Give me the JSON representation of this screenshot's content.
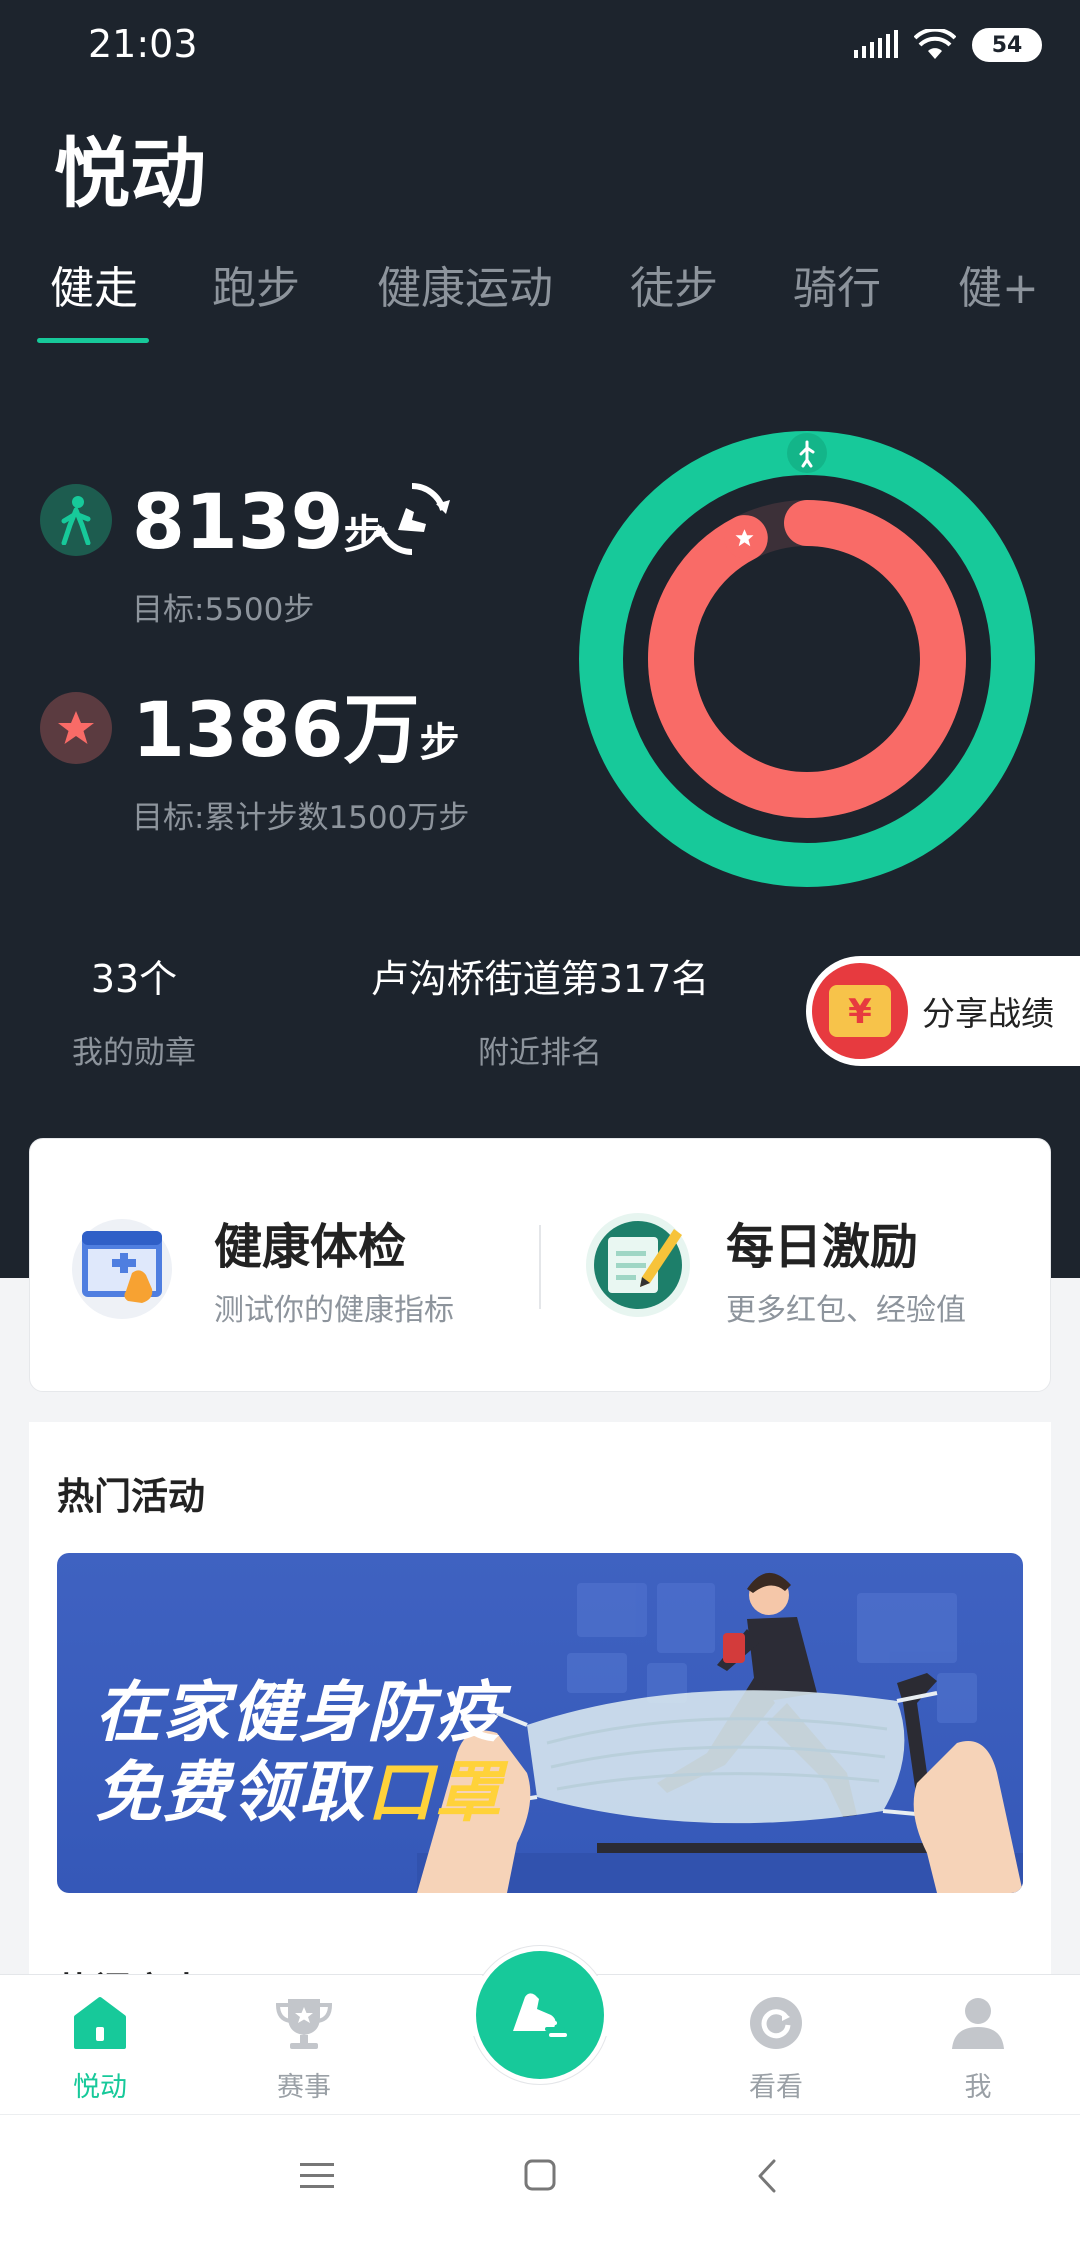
{
  "status": {
    "time": "21:03",
    "battery": "54"
  },
  "app": {
    "title": "悦动"
  },
  "tabs": [
    {
      "label": "健走",
      "active": true
    },
    {
      "label": "跑步"
    },
    {
      "label": "健康运动"
    },
    {
      "label": "徒步"
    },
    {
      "label": "骑行"
    },
    {
      "label": "健+"
    }
  ],
  "stats": {
    "today_steps": "8139",
    "today_unit": "步",
    "today_goal": "目标:5500步",
    "total_steps": "1386万",
    "total_unit": "步",
    "total_goal": "目标:累计步数1500万步"
  },
  "rings": {
    "outer_progress": 1.0,
    "inner_progress": 0.924,
    "outer_color": "#17c99a",
    "inner_color": "#f96b67"
  },
  "summary": {
    "medals_value": "33个",
    "medals_label": "我的勋章",
    "rank_value": "卢沟桥街道第317名",
    "rank_label": "附近排名",
    "share_label": "分享战绩",
    "share_symbol": "¥"
  },
  "cards": {
    "health_check_title": "健康体检",
    "health_check_sub": "测试你的健康指标",
    "daily_title": "每日激励",
    "daily_sub": "更多红包、经验值"
  },
  "activities": {
    "section_title": "热门活动",
    "banner_line1": "在家健身防疫",
    "banner_line2_a": "免费领取",
    "banner_line2_b": "口罩",
    "next_section_peek": "热门赛事"
  },
  "bottom_nav": [
    {
      "label": "悦动",
      "icon": "home-icon",
      "active": true
    },
    {
      "label": "赛事",
      "icon": "trophy-icon"
    },
    {
      "label": "",
      "icon": "run-shoe-icon"
    },
    {
      "label": "看看",
      "icon": "refresh-icon"
    },
    {
      "label": "我",
      "icon": "person-icon"
    }
  ],
  "colors": {
    "accent": "#17c99a",
    "dark_bg": "#1d242d",
    "coral": "#f96b67"
  }
}
